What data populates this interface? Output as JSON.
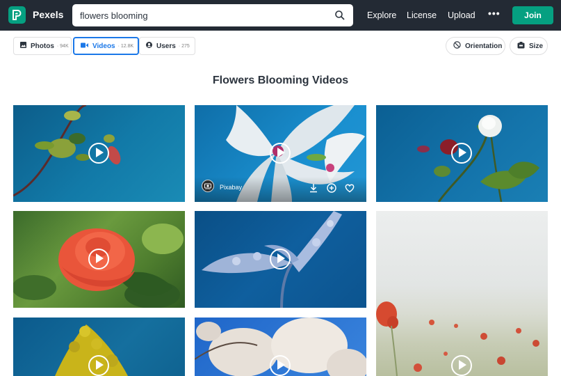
{
  "header": {
    "brand": "Pexels",
    "search_value": "flowers blooming",
    "nav": [
      "Explore",
      "License",
      "Upload"
    ],
    "more": "•••",
    "join_label": "Join"
  },
  "filters": {
    "tabs": [
      {
        "label": "Photos",
        "count": "· 94K"
      },
      {
        "label": "Videos",
        "count": "· 12.8K"
      },
      {
        "label": "Users",
        "count": "· 275"
      }
    ],
    "orientation_label": "Orientation",
    "size_label": "Size"
  },
  "page_title": "Flowers Blooming Videos",
  "hover_card": {
    "author": "Pixabay",
    "author_logo_text": "pixabay"
  },
  "colors": {
    "accent": "#05a081",
    "header_bg": "#232a34",
    "active_tab": "#1b78e8"
  },
  "icons": [
    "search-icon",
    "photo-icon",
    "video-icon",
    "user-icon",
    "orientation-icon",
    "size-icon",
    "play-icon",
    "download-icon",
    "add-collection-icon",
    "heart-icon"
  ]
}
